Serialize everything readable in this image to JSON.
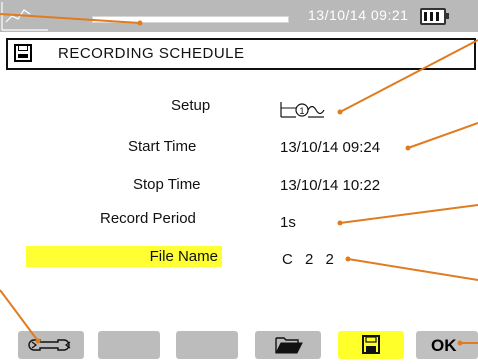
{
  "status_bar": {
    "datetime": "13/10/14 09:21",
    "progress_fraction": 0.05,
    "battery_level": 3
  },
  "header": {
    "title": "RECORDING SCHEDULE"
  },
  "form": {
    "setup_label": "Setup",
    "start_time_label": "Start Time",
    "start_time_value": "13/10/14 09:24",
    "stop_time_label": "Stop Time",
    "stop_time_value": "13/10/14 10:22",
    "record_period_label": "Record Period",
    "record_period_value": "1s",
    "file_name_label": "File Name",
    "file_name_value": "C 2 2"
  },
  "function_buttons": {
    "ok_label": "OK",
    "icons": [
      "wrench-icon",
      "blank",
      "blank",
      "open-folder-icon",
      "save-icon",
      "ok"
    ]
  },
  "colors": {
    "topbar": "#b9b9b9",
    "highlight": "#ffff33",
    "annotation_line": "#e07b1f"
  }
}
